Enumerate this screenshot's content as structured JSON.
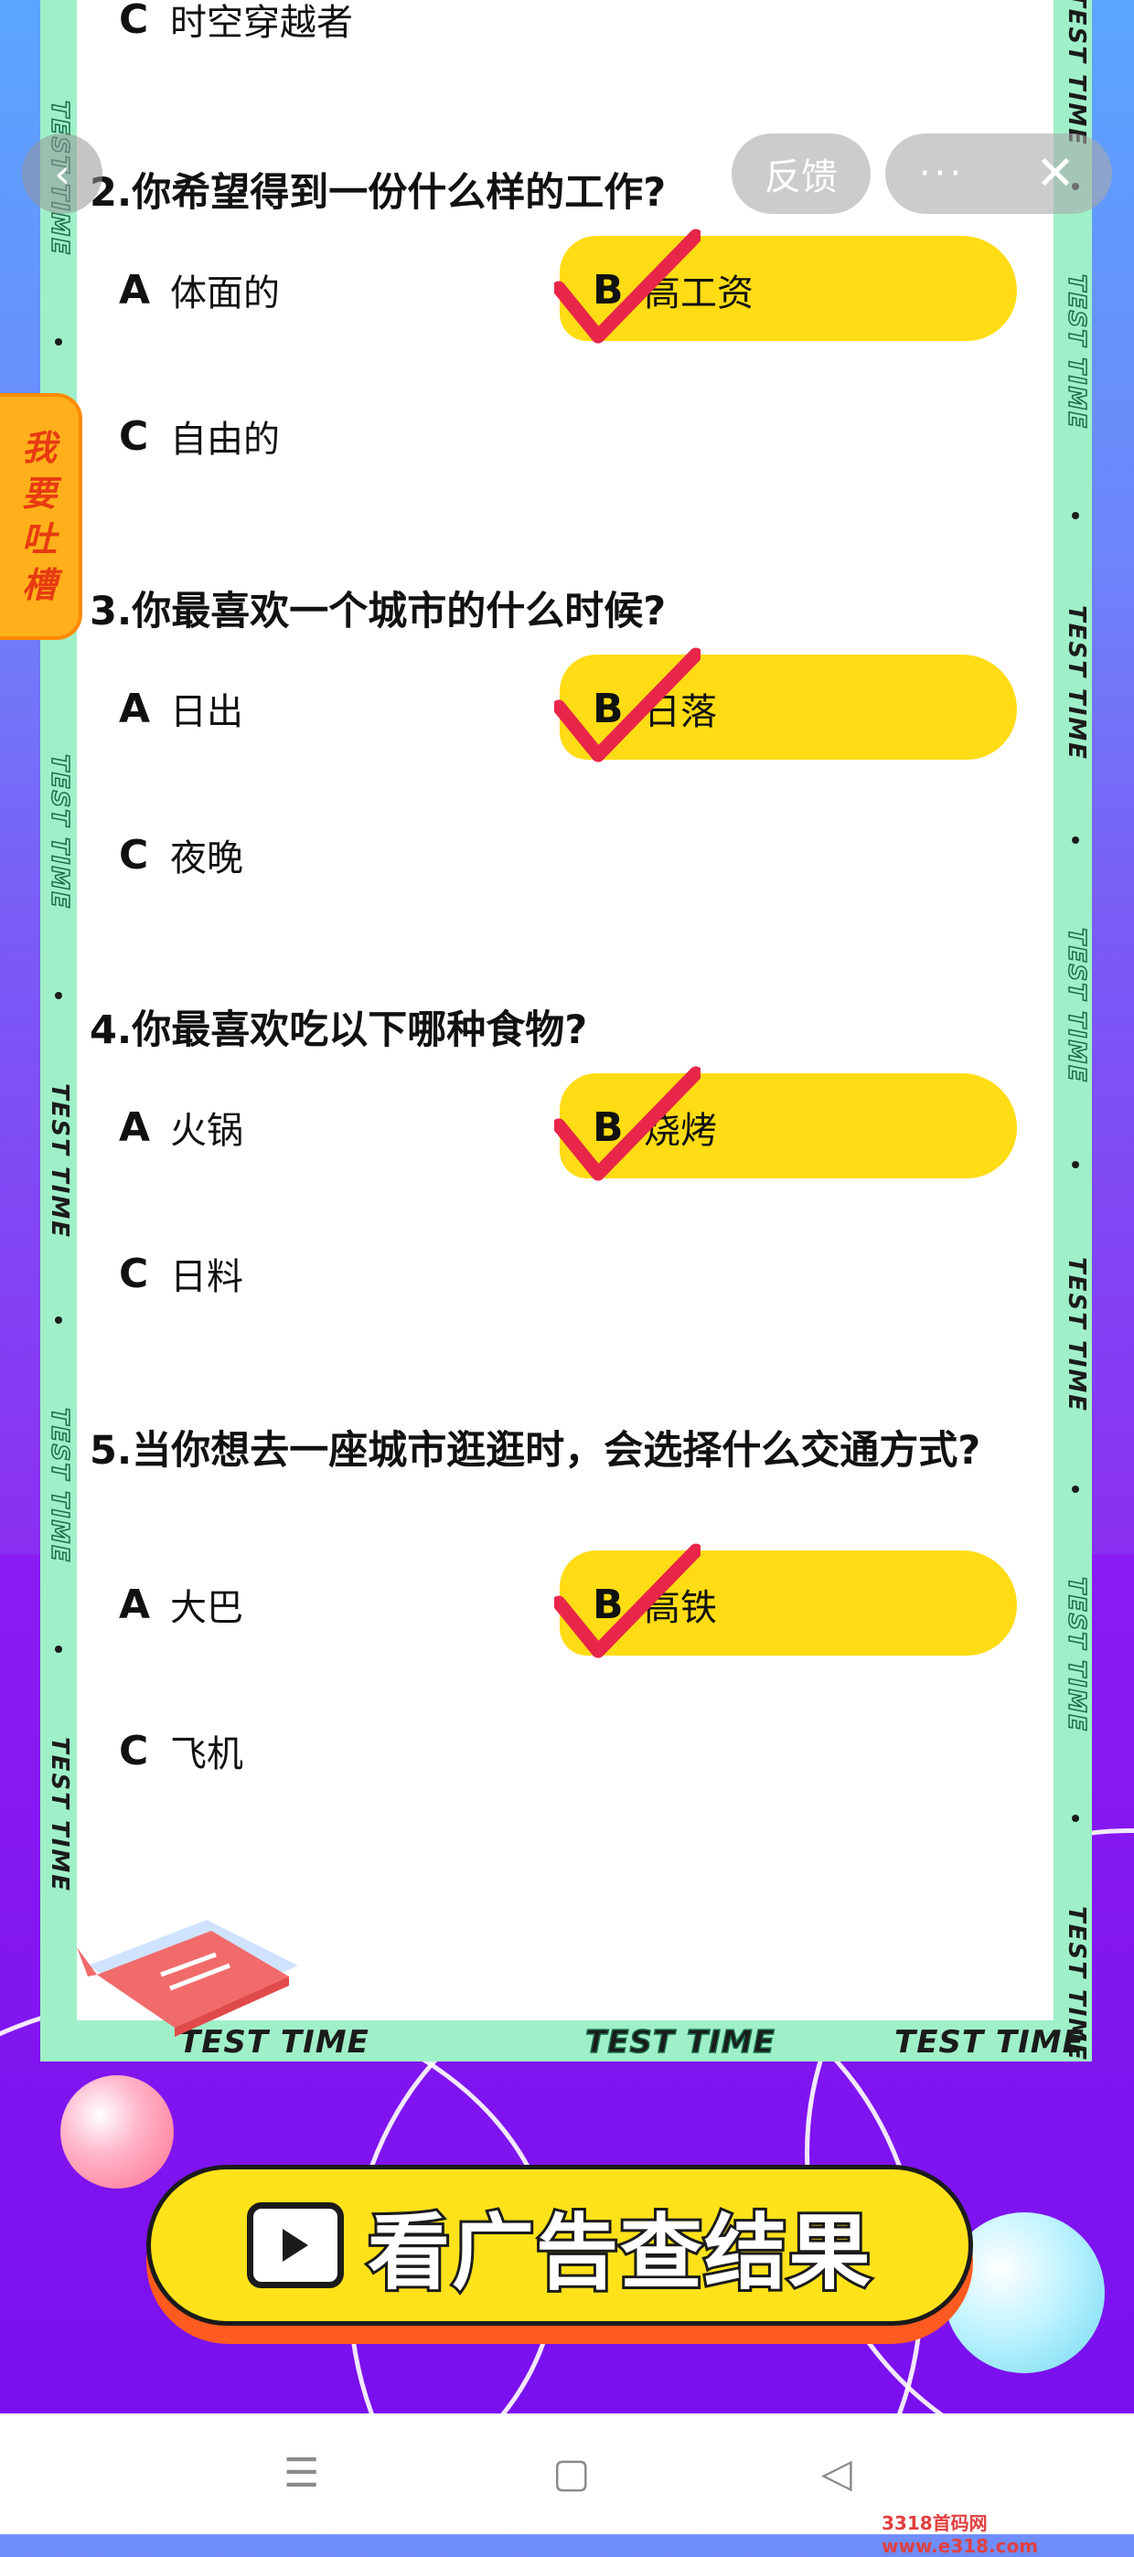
{
  "overlay": {
    "back_icon": "‹",
    "feedback_label": "反馈",
    "more_icon": "···",
    "close_icon": "✕",
    "complain_chars": [
      "我",
      "要",
      "吐",
      "槽"
    ]
  },
  "frame": {
    "side_text": "TEST TIME",
    "bottom_texts": [
      "TEST TIME",
      "TEST TIME",
      "TEST TIME"
    ]
  },
  "questions": [
    {
      "title": "",
      "options": [
        {
          "letter": "C",
          "text": "时空穿越者",
          "selected": false
        }
      ]
    },
    {
      "title": "2.你希望得到一份什么样的工作?",
      "options": [
        {
          "letter": "A",
          "text": "体面的",
          "selected": false
        },
        {
          "letter": "B",
          "text": "高工资",
          "selected": true
        },
        {
          "letter": "C",
          "text": "自由的",
          "selected": false
        }
      ]
    },
    {
      "title": "3.你最喜欢一个城市的什么时候?",
      "options": [
        {
          "letter": "A",
          "text": "日出",
          "selected": false
        },
        {
          "letter": "B",
          "text": "日落",
          "selected": true
        },
        {
          "letter": "C",
          "text": "夜晚",
          "selected": false
        }
      ]
    },
    {
      "title": "4.你最喜欢吃以下哪种食物?",
      "options": [
        {
          "letter": "A",
          "text": "火锅",
          "selected": false
        },
        {
          "letter": "B",
          "text": "烧烤",
          "selected": true
        },
        {
          "letter": "C",
          "text": "日料",
          "selected": false
        }
      ]
    },
    {
      "title": "5.当你想去一座城市逛逛时，会选择什么交通方式?",
      "options": [
        {
          "letter": "A",
          "text": "大巴",
          "selected": false
        },
        {
          "letter": "B",
          "text": "高铁",
          "selected": true
        },
        {
          "letter": "C",
          "text": "飞机",
          "selected": false
        }
      ]
    }
  ],
  "cta": {
    "label": "看广告查结果",
    "icon": "video-clapper-icon"
  },
  "navbar": {
    "menu_icon": "☰",
    "home_icon": "▢",
    "back_icon": "◁"
  },
  "watermark": "3318首码网www.e318.com",
  "colors": {
    "highlight": "#ffdc14",
    "check": "#e8264a",
    "frame_green": "#9ff0c9",
    "cta_yellow": "#ffe21a"
  }
}
